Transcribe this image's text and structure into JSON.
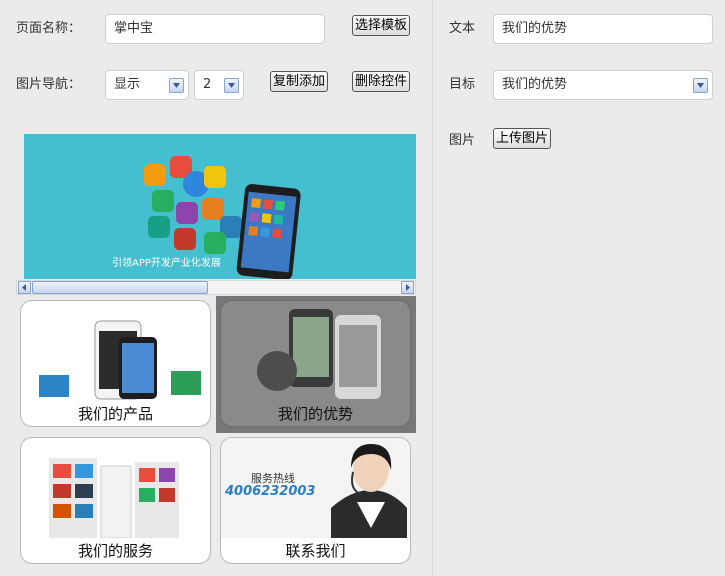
{
  "form": {
    "page_name_label": "页面名称：",
    "page_name_value": "掌中宝",
    "select_template_button": "选择模板",
    "nav_label": "图片导航：",
    "nav_display_value": "显示",
    "nav_count_value": "2",
    "copy_add_button": "复制添加",
    "delete_control_button": "删除控件"
  },
  "banner": {
    "caption": "引领APP开发产业化发展"
  },
  "cards": [
    {
      "label": "我们的产品"
    },
    {
      "label": "我们的优势"
    },
    {
      "label": "我们的服务"
    },
    {
      "label": "联系我们"
    }
  ],
  "hotline": {
    "title": "服务热线",
    "number": "4006232003"
  },
  "right_panel": {
    "text_label": "文本",
    "text_value": "我们的优势",
    "target_label": "目标",
    "target_value": "我们的优势",
    "image_label": "图片",
    "upload_button": "上传图片"
  },
  "colors": {
    "banner_bg": "#45bfd0",
    "selected_card_overlay": "#777777"
  }
}
